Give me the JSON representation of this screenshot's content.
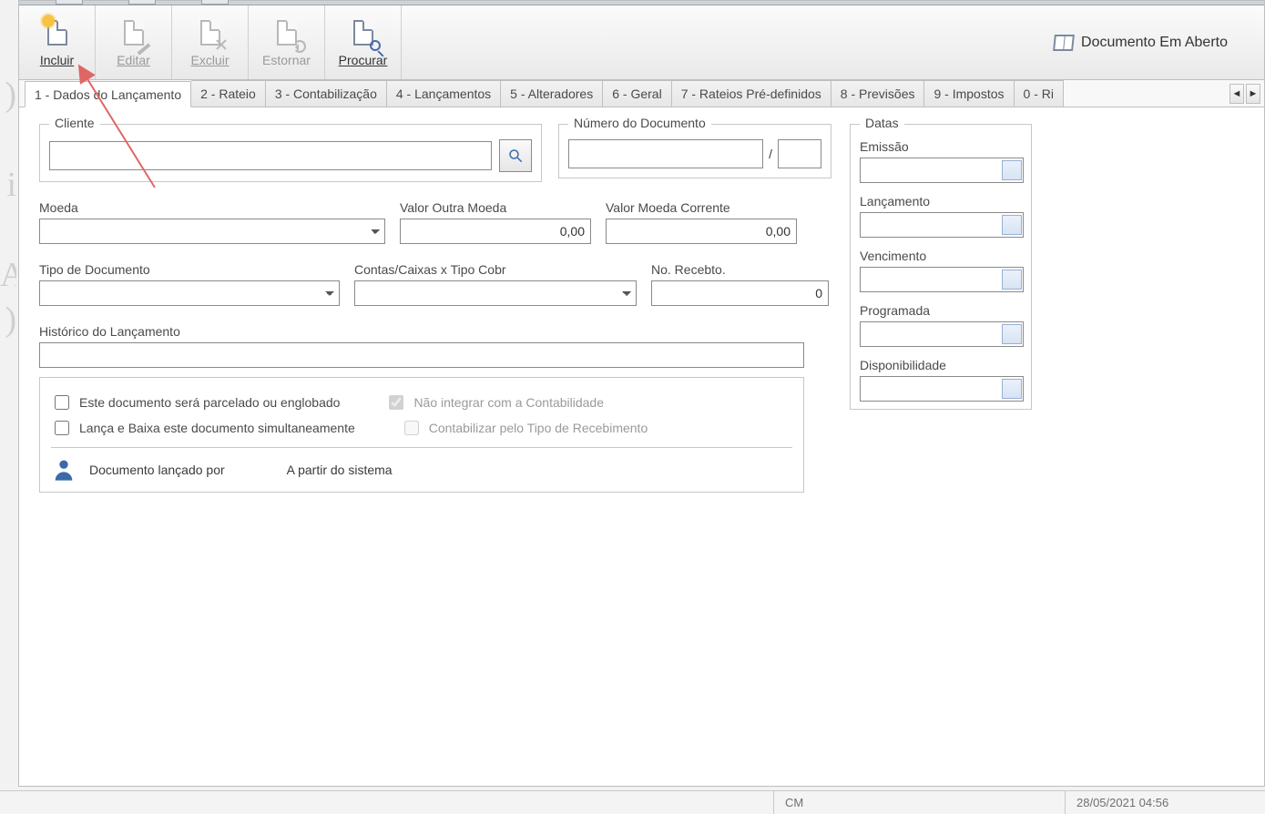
{
  "toolbar": {
    "incluir": "Incluir",
    "editar": "Editar",
    "excluir": "Excluir",
    "estornar": "Estornar",
    "procurar": "Procurar",
    "status_label": "Documento Em Aberto"
  },
  "tabs": [
    {
      "label": "1 - Dados do Lançamento"
    },
    {
      "label": "2 - Rateio"
    },
    {
      "label": "3 - Contabilização"
    },
    {
      "label": "4 - Lançamentos"
    },
    {
      "label": "5 - Alteradores"
    },
    {
      "label": "6 - Geral"
    },
    {
      "label": "7 - Rateios Pré-definidos"
    },
    {
      "label": "8 - Previsões"
    },
    {
      "label": "9 - Impostos"
    },
    {
      "label": "0 - Ri"
    }
  ],
  "tab_scroll": {
    "left": "◄",
    "right": "►"
  },
  "form": {
    "cliente_legend": "Cliente",
    "cliente_value": "",
    "docnum_legend": "Número do Documento",
    "docnum_value": "",
    "docnum_sep": "/",
    "docnum_suffix": "",
    "moeda_label": "Moeda",
    "moeda_value": "",
    "valor_outra_label": "Valor Outra Moeda",
    "valor_outra_value": "0,00",
    "valor_corr_label": "Valor Moeda Corrente",
    "valor_corr_value": "0,00",
    "tipo_doc_label": "Tipo de Documento",
    "tipo_doc_value": "",
    "contas_label": "Contas/Caixas x Tipo Cobr",
    "contas_value": "",
    "no_receb_label": "No. Recebto.",
    "no_receb_value": "0",
    "historico_label": "Histórico do Lançamento",
    "historico_value": "",
    "chk_parcelado": "Este documento será parcelado ou englobado",
    "chk_lanca_baixa": "Lança e Baixa este documento simultaneamente",
    "chk_nao_integrar": "Não integrar com a Contabilidade",
    "chk_contab_tipo": "Contabilizar pelo Tipo de Recebimento",
    "lancado_por_label": "Documento lançado por",
    "lancado_por_value": "A partir do sistema"
  },
  "dates": {
    "legend": "Datas",
    "emissao_label": "Emissão",
    "emissao_value": "",
    "lancamento_label": "Lançamento",
    "lancamento_value": "",
    "vencimento_label": "Vencimento",
    "vencimento_value": "",
    "programada_label": "Programada",
    "programada_value": "",
    "disponibilidade_label": "Disponibilidade",
    "disponibilidade_value": ""
  },
  "statusbar": {
    "mode": "CM",
    "datetime": "28/05/2021 04:56"
  }
}
